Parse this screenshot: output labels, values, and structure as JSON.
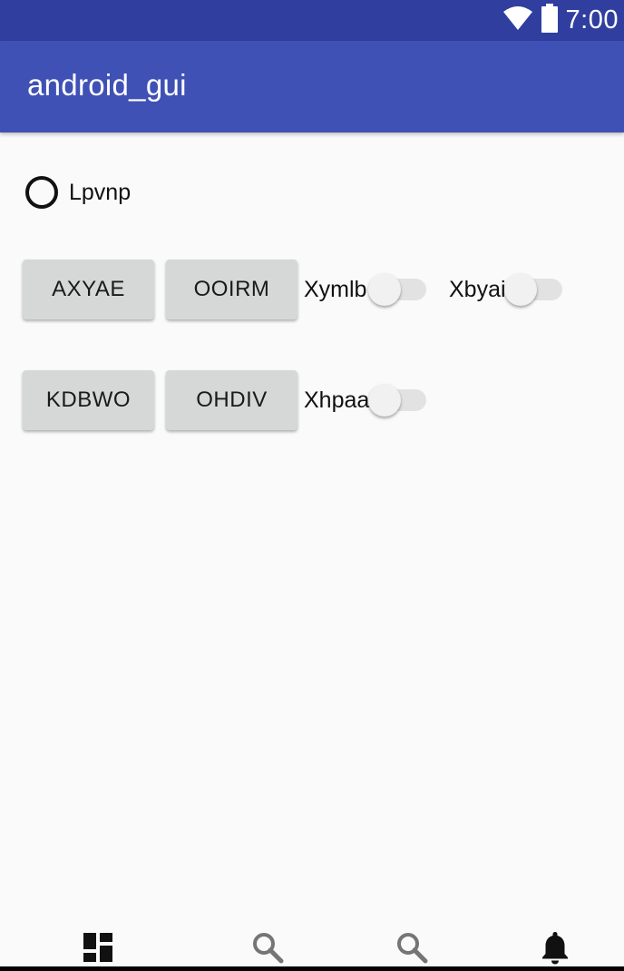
{
  "status_bar": {
    "time": "7:00",
    "icons": [
      "wifi-icon",
      "battery-icon"
    ],
    "color": "#303f9f"
  },
  "app_bar": {
    "title": "android_gui",
    "color": "#3f51b5"
  },
  "radio": {
    "label": "Lpvnp",
    "checked": false
  },
  "buttons": {
    "row1": [
      "AXYAE",
      "OOIRM"
    ],
    "row2": [
      "KDBWO",
      "OHDIV"
    ]
  },
  "switches": [
    {
      "label": "Xymlb",
      "on": false
    },
    {
      "label": "Xbyai",
      "on": false
    },
    {
      "label": "Xhpaa",
      "on": false
    }
  ],
  "bottom_nav": {
    "items": [
      "dashboard-icon",
      "search-icon",
      "search-icon",
      "notifications-icon"
    ],
    "active_color": "#111111",
    "inactive_color": "#757575"
  }
}
